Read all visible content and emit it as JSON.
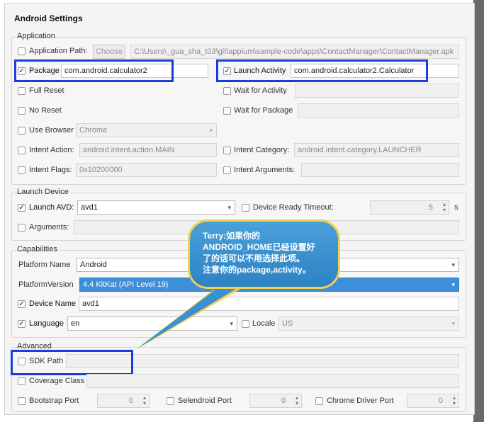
{
  "window": {
    "title": "Android Settings"
  },
  "application": {
    "group_label": "Application",
    "app_path": {
      "label": "Application Path:",
      "checked": false,
      "choose_label": "Choose",
      "value": "C:\\Users\\_gua_sha_t03\\git\\appium\\sample-code\\apps\\ContactManager\\ContactManager.apk"
    },
    "package": {
      "label": "Package",
      "checked": true,
      "value": "com.android.calculator2"
    },
    "launch_activity": {
      "label": "Launch Activity",
      "checked": true,
      "value": "com.android.calculator2.Calculator"
    },
    "full_reset": {
      "label": "Full Reset",
      "checked": false
    },
    "wait_activity": {
      "label": "Wait for Activity",
      "checked": false,
      "value": ""
    },
    "no_reset": {
      "label": "No Reset",
      "checked": false
    },
    "wait_package": {
      "label": "Wait for Package",
      "checked": false,
      "value": ""
    },
    "use_browser": {
      "label": "Use Browser",
      "checked": false,
      "value": "Chrome"
    },
    "intent_action": {
      "label": "Intent Action:",
      "checked": false,
      "value": "android.intent.action.MAIN"
    },
    "intent_category": {
      "label": "Intent Category:",
      "checked": false,
      "value": "android.intent.category.LAUNCHER"
    },
    "intent_flags": {
      "label": "Intent Flags:",
      "checked": false,
      "value": "0x10200000"
    },
    "intent_arguments": {
      "label": "Intent Arguments:",
      "checked": false,
      "value": ""
    }
  },
  "launch_device": {
    "group_label": "Launch Device",
    "launch_avd": {
      "label": "Launch AVD:",
      "checked": true,
      "value": "avd1"
    },
    "ready_timeout": {
      "label": "Device Ready Timeout:",
      "checked": false,
      "value": "5",
      "unit": "s"
    },
    "arguments": {
      "label": "Arguments:",
      "checked": false,
      "value": ""
    }
  },
  "capabilities": {
    "group_label": "Capabilities",
    "platform_name": {
      "label": "Platform Name",
      "value": "Android"
    },
    "platform_version": {
      "label": "PlatformVersion",
      "value": "4.4 KitKat (API Level 19)"
    },
    "device_name": {
      "label": "Device Name",
      "checked": true,
      "value": "avd1"
    },
    "language": {
      "label": "Language",
      "checked": true,
      "value": "en"
    },
    "locale": {
      "label": "Locale",
      "checked": false,
      "value": "US"
    }
  },
  "advanced": {
    "group_label": "Advanced",
    "sdk_path": {
      "label": "SDK Path",
      "checked": false,
      "value": ""
    },
    "coverage_class": {
      "label": "Coverage Class",
      "checked": false,
      "value": ""
    },
    "bootstrap_port": {
      "label": "Bootstrap Port",
      "checked": false,
      "value": "0"
    },
    "selendroid_port": {
      "label": "Selendroid Port",
      "checked": false,
      "value": "0"
    },
    "chrome_driver_port": {
      "label": "Chrome Driver Port",
      "checked": false,
      "value": "0"
    }
  },
  "annotation": {
    "lines": [
      "Terry:如果你的",
      "ANDROID_HOME已经设置好",
      "了的话可以不用选择此项。",
      "注意你的package,activity。"
    ],
    "highlight_color": "#1a3fd6",
    "bubble_border_color": "#f3d04a"
  },
  "glyphs": {
    "check": "✓",
    "dropdown": "▾",
    "spin_up": "▴",
    "spin_down": "▾"
  }
}
